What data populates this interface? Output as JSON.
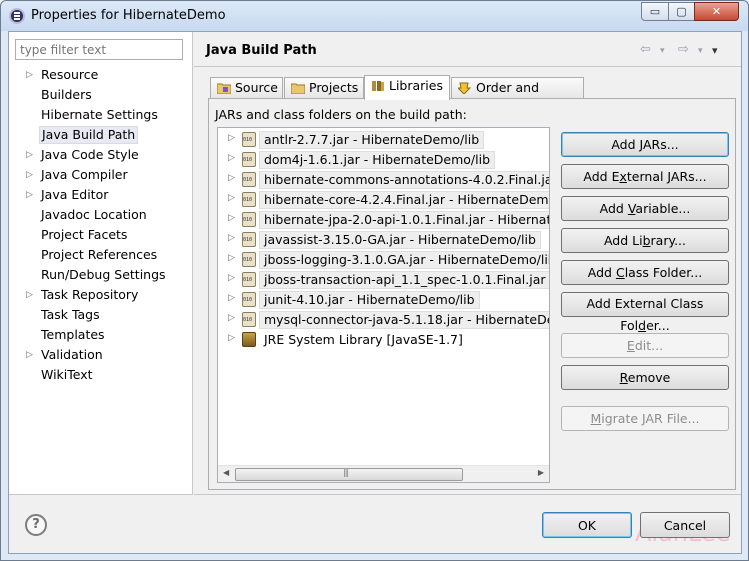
{
  "window": {
    "title": "Properties for HibernateDemo",
    "minimize_glyph": "▭",
    "maximize_glyph": "▢",
    "close_glyph": "✕"
  },
  "sidebar": {
    "filter_placeholder": "type filter text",
    "items": [
      {
        "label": "Resource",
        "expandable": true
      },
      {
        "label": "Builders",
        "expandable": false
      },
      {
        "label": "Hibernate Settings",
        "expandable": false
      },
      {
        "label": "Java Build Path",
        "expandable": false,
        "selected": true
      },
      {
        "label": "Java Code Style",
        "expandable": true
      },
      {
        "label": "Java Compiler",
        "expandable": true
      },
      {
        "label": "Java Editor",
        "expandable": true
      },
      {
        "label": "Javadoc Location",
        "expandable": false
      },
      {
        "label": "Project Facets",
        "expandable": false
      },
      {
        "label": "Project References",
        "expandable": false
      },
      {
        "label": "Run/Debug Settings",
        "expandable": false
      },
      {
        "label": "Task Repository",
        "expandable": true
      },
      {
        "label": "Task Tags",
        "expandable": false
      },
      {
        "label": "Templates",
        "expandable": false
      },
      {
        "label": "Validation",
        "expandable": true
      },
      {
        "label": "WikiText",
        "expandable": false
      }
    ]
  },
  "page": {
    "title": "Java Build Path",
    "nav_back": "⇦",
    "nav_forward": "⇨",
    "nav_menu": "▾",
    "tabs": [
      {
        "label": "Source",
        "active": false
      },
      {
        "label": "Projects",
        "active": false
      },
      {
        "label": "Libraries",
        "active": true
      },
      {
        "label": "Order and Export",
        "active": false
      }
    ],
    "panel_label": "JARs and class folders on the build path:",
    "libraries": [
      {
        "label": "antlr-2.7.7.jar - HibernateDemo/lib",
        "icon": "jar-icon"
      },
      {
        "label": "dom4j-1.6.1.jar - HibernateDemo/lib",
        "icon": "jar-icon"
      },
      {
        "label": "hibernate-commons-annotations-4.0.2.Final.jar - H",
        "icon": "jar-icon"
      },
      {
        "label": "hibernate-core-4.2.4.Final.jar - HibernateDemo/lib",
        "icon": "jar-icon"
      },
      {
        "label": "hibernate-jpa-2.0-api-1.0.1.Final.jar - HibernateDe",
        "icon": "jar-icon"
      },
      {
        "label": "javassist-3.15.0-GA.jar - HibernateDemo/lib",
        "icon": "jar-icon"
      },
      {
        "label": "jboss-logging-3.1.0.GA.jar - HibernateDemo/lib",
        "icon": "jar-icon"
      },
      {
        "label": "jboss-transaction-api_1.1_spec-1.0.1.Final.jar - Hib",
        "icon": "jar-icon"
      },
      {
        "label": "junit-4.10.jar - HibernateDemo/lib",
        "icon": "jar-icon"
      },
      {
        "label": "mysql-connector-java-5.1.18.jar - HibernateDemo/",
        "icon": "jar-icon"
      },
      {
        "label": "JRE System Library [JavaSE-1.7]",
        "icon": "jre-library-icon"
      }
    ],
    "buttons": {
      "add_jars": {
        "pre": "Add ",
        "key": "J",
        "post": "ARs...",
        "enabled": true
      },
      "add_external_jars": {
        "pre": "Add E",
        "key": "x",
        "post": "ternal JARs...",
        "enabled": true
      },
      "add_variable": {
        "pre": "Add ",
        "key": "V",
        "post": "ariable...",
        "enabled": true
      },
      "add_library": {
        "pre": "Add Li",
        "key": "b",
        "post": "rary...",
        "enabled": true
      },
      "add_class_folder": {
        "pre": "Add ",
        "key": "C",
        "post": "lass Folder...",
        "enabled": true
      },
      "add_external_class_folder": {
        "pre": "Add External Class Fol",
        "key": "d",
        "post": "er...",
        "enabled": true
      },
      "edit": {
        "pre": "",
        "key": "E",
        "post": "dit...",
        "enabled": false
      },
      "remove": {
        "pre": "",
        "key": "R",
        "post": "emove",
        "enabled": true
      },
      "migrate_jar": {
        "pre": "",
        "key": "M",
        "post": "igrate JAR File...",
        "enabled": false
      }
    },
    "watermark": "AlanLee"
  },
  "footer": {
    "help": "?",
    "ok": "OK",
    "cancel": "Cancel"
  }
}
